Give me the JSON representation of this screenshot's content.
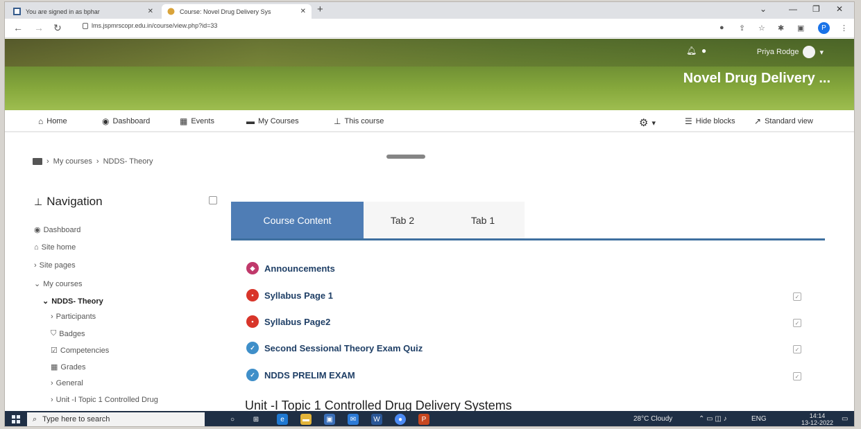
{
  "browser": {
    "tabs": [
      {
        "title": "You are signed in as bphar",
        "active": false
      },
      {
        "title": "Course: Novel Drug Delivery Sys",
        "active": true
      }
    ],
    "new_tab": "+",
    "url": "lms.jspmrscopr.edu.in/course/view.php?id=33",
    "profile_initial": "P"
  },
  "header": {
    "user_name": "Priya Rodge",
    "course_title": "Novel Drug Delivery ..."
  },
  "navbar": {
    "items": [
      "Home",
      "Dashboard",
      "Events",
      "My Courses",
      "This course"
    ],
    "hide_blocks": "Hide blocks",
    "standard_view": "Standard view"
  },
  "breadcrumb": {
    "items": [
      "My courses",
      "NDDS- Theory"
    ]
  },
  "navigation_block": {
    "title": "Navigation",
    "items": [
      "Dashboard",
      "Site home",
      "Site pages",
      "My courses",
      "NDDS- Theory",
      "Participants",
      "Badges",
      "Competencies",
      "Grades",
      "General",
      "Unit -I Topic 1 Controlled Drug"
    ]
  },
  "course_tabs": [
    "Course Content",
    "Tab 2",
    "Tab 1"
  ],
  "activities": [
    {
      "name": "Announcements",
      "icon": "forum-icon"
    },
    {
      "name": "Syllabus Page 1",
      "icon": "pdf-icon"
    },
    {
      "name": "Syllabus Page2",
      "icon": "pdf-icon"
    },
    {
      "name": "Second Sessional Theory Exam Quiz",
      "icon": "quiz-icon"
    },
    {
      "name": "NDDS PRELIM EXAM",
      "icon": "quiz-icon"
    }
  ],
  "section_title": "Unit -I Topic 1 Controlled Drug Delivery Systems",
  "taskbar": {
    "search_placeholder": "Type here to search",
    "weather": "28°C  Cloudy",
    "language": "ENG",
    "time": "14:14",
    "date": "13-12-2022"
  },
  "colors": {
    "tab_active": "#4f7db5",
    "activity_link": "#1f3f66",
    "banner_green": "#86a83c",
    "taskbar": "#1f2f45"
  }
}
